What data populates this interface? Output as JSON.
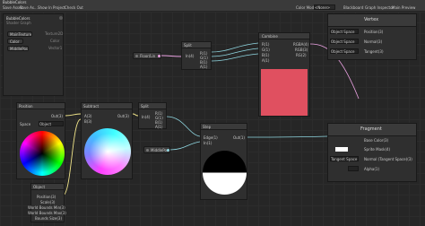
{
  "window": {
    "title": "BubbleColors"
  },
  "toolbar": {
    "save_asset": "Save Asset",
    "save_as": "Save As...",
    "show_in_project": "Show In Project",
    "check_out": "Check Out",
    "color_mode_label": "Color Mode",
    "color_mode_value": "<None>",
    "blackboard": "Blackboard",
    "graph_inspector": "Graph Inspector",
    "main_preview": "Main Preview"
  },
  "blackboard": {
    "title": "BubbleColors",
    "subtitle": "Shader Graph",
    "properties": [
      {
        "name": "MainTexture",
        "type": "Texture2D"
      },
      {
        "name": "Color",
        "type": "Color"
      },
      {
        "name": "MiddlePos",
        "type": "Vector1"
      }
    ]
  },
  "nodes": {
    "property_pill": {
      "label": "Floor/Lin"
    },
    "split_top": {
      "title": "Split",
      "input": "In(4)",
      "outputs": [
        "R(1)",
        "G(1)",
        "B(1)",
        "A(1)"
      ]
    },
    "combine": {
      "title": "Combine",
      "inputs": [
        "R(1)",
        "G(1)",
        "B(1)",
        "A(1)"
      ],
      "outputs": [
        "RGBA(4)",
        "RGB(3)",
        "RG(2)"
      ],
      "preview_color": "#e05060"
    },
    "position": {
      "title": "Position",
      "output": "Out(3)",
      "space_label": "Space",
      "space_value": "Object"
    },
    "subtract": {
      "title": "Subtract",
      "inputs": [
        "A(3)",
        "B(3)"
      ],
      "output": "Out(3)"
    },
    "split_mid": {
      "title": "Split",
      "input": "In(4)",
      "outputs": [
        "R(1)",
        "G(1)",
        "B(1)",
        "A(1)"
      ]
    },
    "step": {
      "title": "Step",
      "inputs": [
        "Edge(1)",
        "In(1)"
      ],
      "output": "Out(1)"
    },
    "middle_pill": {
      "label": "MiddlePos"
    },
    "object": {
      "title": "Object",
      "outputs": [
        "Position(3)",
        "Scale(3)",
        "World Bounds Min(3)",
        "World Bounds Max(3)",
        "Bounds Size(3)"
      ]
    }
  },
  "vertex": {
    "title": "Vertex",
    "slots": [
      {
        "space": "Object Space",
        "label": "Position(3)"
      },
      {
        "space": "Object Space",
        "label": "Normal(3)"
      },
      {
        "space": "Object Space",
        "label": "Tangent(3)"
      }
    ]
  },
  "fragment": {
    "title": "Fragment",
    "slots": [
      {
        "space": "",
        "label": "Base Color(3)"
      },
      {
        "space": "",
        "label": "Sprite Mask(4)"
      },
      {
        "space": "Tangent Space",
        "label": "Normal (Tangent Space)(3)"
      },
      {
        "space": "",
        "label": "Alpha(1)"
      }
    ]
  },
  "colors": {
    "accent": "#6fd06f",
    "combine_preview": "#e05060",
    "edge_float": "#8fd6e0",
    "edge_vec3": "#f2e68a",
    "edge_vec4": "#e8a0e0"
  }
}
